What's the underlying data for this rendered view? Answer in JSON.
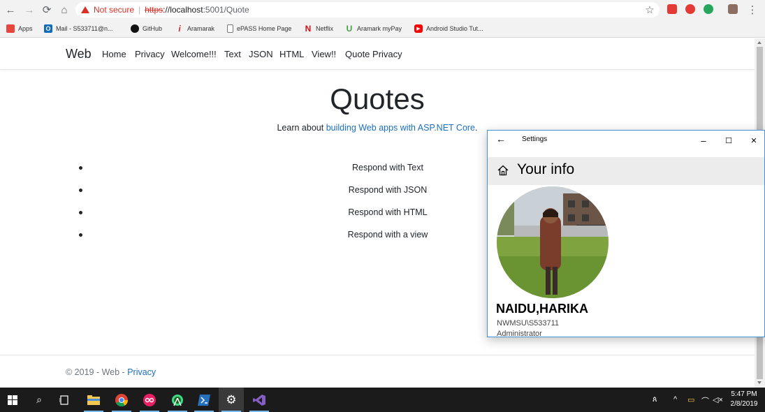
{
  "browser": {
    "security_label": "Not secure",
    "url_scheme": "https",
    "url_separator": "://",
    "url_host": "localhost",
    "url_path": ":5001/Quote",
    "bookmarks": [
      {
        "label": "Apps",
        "icon": "apps-grid-icon",
        "color": "#e8453c"
      },
      {
        "label": "Mail - S533711@n...",
        "icon": "outlook-icon",
        "color": "#0f6cbd"
      },
      {
        "label": "GitHub",
        "icon": "github-icon",
        "color": "#111111"
      },
      {
        "label": "Aramarak",
        "icon": "info-icon",
        "color": "#c62828"
      },
      {
        "label": "ePASS Home Page",
        "icon": "page-icon",
        "color": "#777777"
      },
      {
        "label": "Netflix",
        "icon": "netflix-icon",
        "color": "#e50914"
      },
      {
        "label": "Aramark myPay",
        "icon": "mypay-icon",
        "color": "#43a047"
      },
      {
        "label": "Android Studio Tut...",
        "icon": "youtube-icon",
        "color": "#ff0000"
      }
    ]
  },
  "site": {
    "brand": "Web",
    "nav": [
      "Home",
      "Privacy",
      "Welcome!!!",
      "Text",
      "JSON",
      "HTML",
      "View!!",
      "Quote Privacy"
    ],
    "hero_title": "Quotes",
    "hero_sub_prefix": "Learn about ",
    "hero_sub_link": "building Web apps with ASP.NET Core",
    "hero_sub_suffix": ".",
    "list": [
      "Respond with Text",
      "Respond with JSON",
      "Respond with HTML",
      "Respond with a view"
    ],
    "footer_prefix": "© 2019 - Web - ",
    "footer_link": "Privacy"
  },
  "settings": {
    "title": "Settings",
    "heading": "Your info",
    "user_name": "NAIDU,HARIKA",
    "account": "NWMSU\\S533711",
    "role": "Administrator"
  },
  "taskbar": {
    "apps": [
      "start-icon",
      "search-icon",
      "task-view-icon",
      "file-explorer-icon",
      "chrome-icon",
      "oo-app-icon",
      "android-studio-icon",
      "powershell-icon",
      "settings-icon",
      "visual-studio-icon"
    ],
    "clock_time": "5:47 PM",
    "clock_date": "2/8/2019"
  },
  "colors": {
    "link": "#1b6ec2",
    "warning": "#d93025",
    "window_border": "#4a90d9",
    "taskbar": "#1b1b1b"
  }
}
